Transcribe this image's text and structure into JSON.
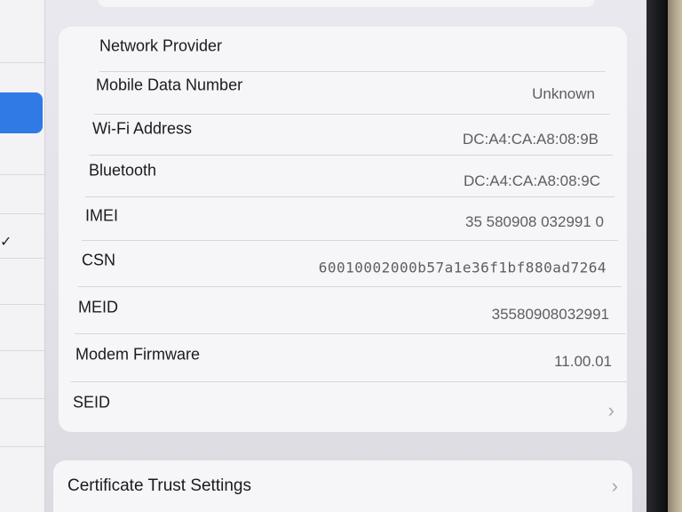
{
  "settings": {
    "rows": [
      {
        "label": "Network Provider",
        "value": ""
      },
      {
        "label": "Mobile Data Number",
        "value": "Unknown"
      },
      {
        "label": "Wi-Fi Address",
        "value": "DC:A4:CA:A8:08:9B"
      },
      {
        "label": "Bluetooth",
        "value": "DC:A4:CA:A8:08:9C"
      },
      {
        "label": "IMEI",
        "value": "35 580908 032991 0"
      },
      {
        "label": "CSN",
        "value": "60010002000b57a1e36f1bf880ad7264"
      },
      {
        "label": "MEID",
        "value": "35580908032991"
      },
      {
        "label": "Modem Firmware",
        "value": "11.00.01"
      },
      {
        "label": "SEID",
        "value": ""
      }
    ],
    "certificate_label": "Certificate Trust Settings"
  },
  "icons": {
    "chevron": "chevron-right-icon",
    "checkmark": "checkmark-icon"
  },
  "colors": {
    "sidebar_selected": "#2f7ae5",
    "background": "#e6e5eb",
    "group_background": "#f6f6f8"
  }
}
